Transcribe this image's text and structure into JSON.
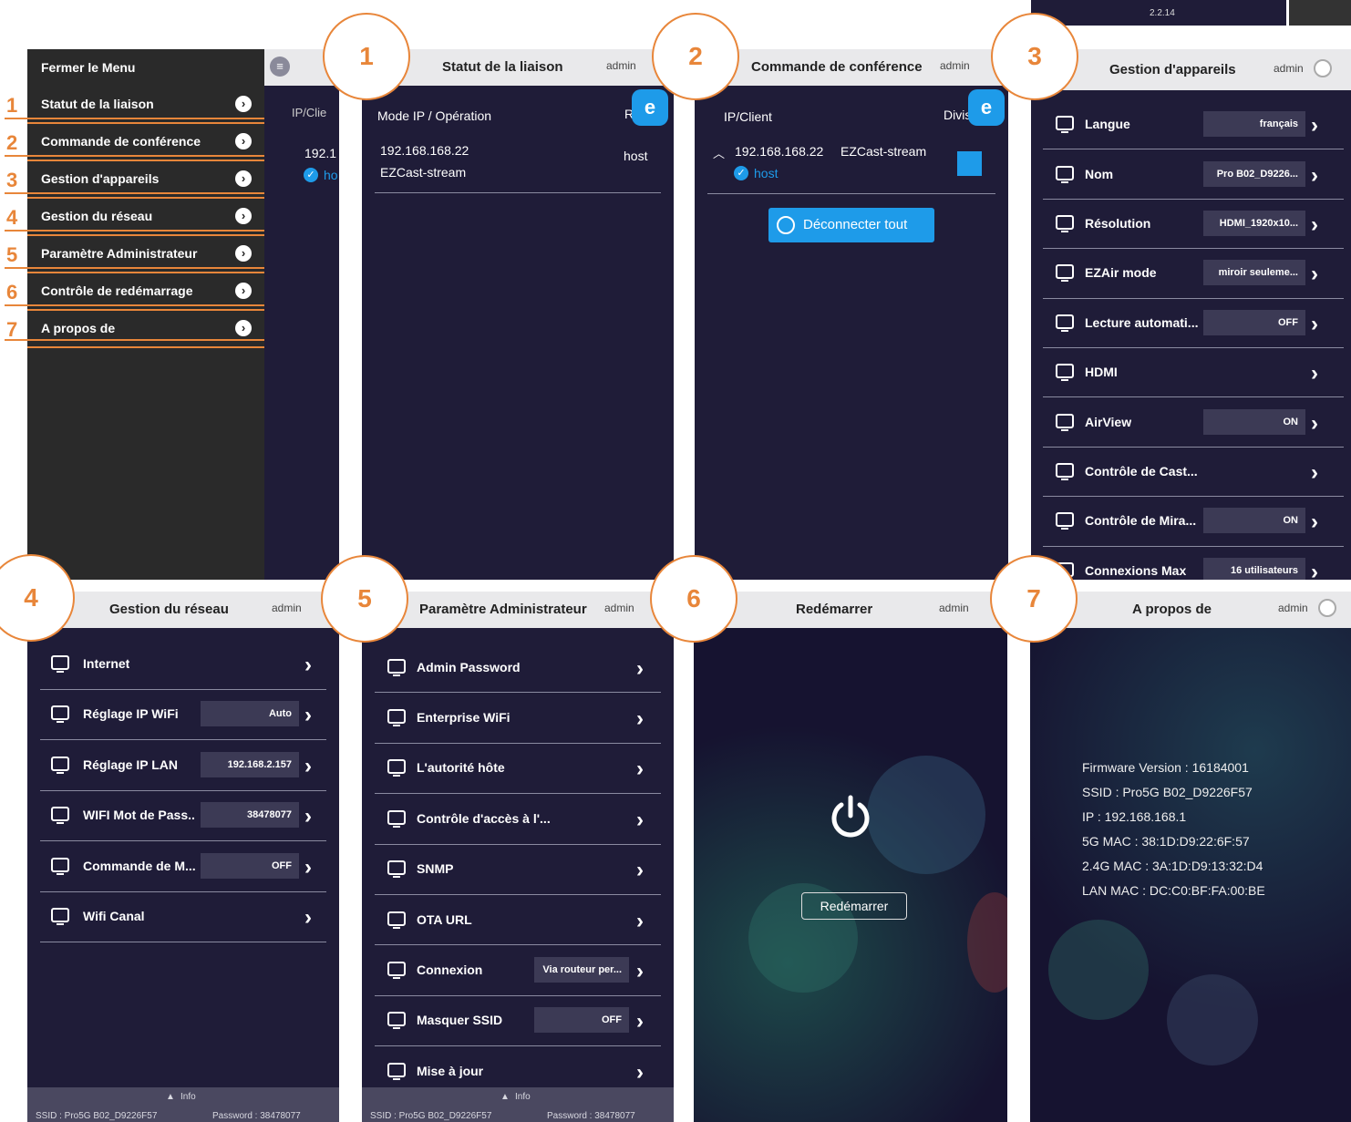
{
  "menu": {
    "close_label": "Fermer le Menu",
    "items": [
      {
        "num": "1",
        "label": "Statut de la liaison"
      },
      {
        "num": "2",
        "label": "Commande de conférence"
      },
      {
        "num": "3",
        "label": "Gestion d'appareils"
      },
      {
        "num": "4",
        "label": "Gestion du réseau"
      },
      {
        "num": "5",
        "label": "Paramètre Administrateur"
      },
      {
        "num": "6",
        "label": "Contrôle de redémarrage"
      },
      {
        "num": "7",
        "label": "A propos de"
      }
    ],
    "bg_col_header": "IP/Clie",
    "bg_row_ip": "192.1",
    "bg_row_host": "ho"
  },
  "circles": [
    "1",
    "2",
    "3",
    "4",
    "5",
    "6",
    "7"
  ],
  "version_label": "2.2.14",
  "user": "admin",
  "link_status": {
    "title": "Statut de la liaison",
    "col_ip": "Mode IP / Opération",
    "col_role": "Rôle",
    "ip": "192.168.168.22",
    "name": "EZCast-stream",
    "role": "host"
  },
  "conference": {
    "title": "Commande de conférence",
    "col_ip": "IP/Client",
    "col_split": "Diviser",
    "ip": "192.168.168.22",
    "name": "EZCast-stream",
    "role": "host",
    "disconnect_label": "Déconnecter tout"
  },
  "device": {
    "title": "Gestion d'appareils",
    "items": [
      {
        "label": "Langue",
        "value": "français"
      },
      {
        "label": "Nom",
        "value": "Pro B02_D9226..."
      },
      {
        "label": "Résolution",
        "value": "HDMI_1920x10..."
      },
      {
        "label": "EZAir mode",
        "value": "miroir seuleme..."
      },
      {
        "label": "Lecture automati...",
        "value": "OFF"
      },
      {
        "label": "HDMI",
        "value": ""
      },
      {
        "label": "AirView",
        "value": "ON"
      },
      {
        "label": "Contrôle de Cast...",
        "value": ""
      },
      {
        "label": "Contrôle de Mira...",
        "value": "ON"
      },
      {
        "label": "Connexions Max",
        "value": "16 utilisateurs"
      }
    ]
  },
  "network": {
    "title": "Gestion du réseau",
    "items": [
      {
        "label": "Internet",
        "value": ""
      },
      {
        "label": "Réglage IP WiFi",
        "value": "Auto"
      },
      {
        "label": "Réglage IP LAN",
        "value": "192.168.2.157"
      },
      {
        "label": "WIFI Mot de Pass..",
        "value": "38478077"
      },
      {
        "label": "Commande de M...",
        "value": "OFF"
      },
      {
        "label": "Wifi Canal",
        "value": ""
      }
    ],
    "footer_info": "Info",
    "footer_ssid": "SSID : Pro5G B02_D9226F57",
    "footer_password": "Password : 38478077"
  },
  "admin": {
    "title": "Paramètre Administrateur",
    "items": [
      {
        "label": "Admin Password",
        "value": ""
      },
      {
        "label": "Enterprise WiFi",
        "value": ""
      },
      {
        "label": "L'autorité hôte",
        "value": ""
      },
      {
        "label": "Contrôle d'accès à l'...",
        "value": ""
      },
      {
        "label": "SNMP",
        "value": ""
      },
      {
        "label": "OTA URL",
        "value": ""
      },
      {
        "label": "Connexion",
        "value": "Via routeur per..."
      },
      {
        "label": "Masquer SSID",
        "value": "OFF"
      },
      {
        "label": "Mise à jour",
        "value": ""
      }
    ],
    "footer_info": "Info",
    "footer_ssid": "SSID : Pro5G B02_D9226F57",
    "footer_password": "Password : 38478077"
  },
  "reboot": {
    "title": "Redémarrer",
    "button_label": "Redémarrer"
  },
  "about": {
    "title": "A propos de",
    "lines": [
      "Firmware Version : 16184001",
      "SSID : Pro5G B02_D9226F57",
      "IP : 192.168.168.1",
      "5G MAC : 38:1D:D9:22:6F:57",
      "2.4G MAC : 3A:1D:D9:13:32:D4",
      "LAN MAC : DC:C0:BF:FA:00:BE"
    ]
  },
  "colors": {
    "accent": "#e8863a",
    "panel_bg": "#1f1c38",
    "blue": "#1e9be9"
  }
}
